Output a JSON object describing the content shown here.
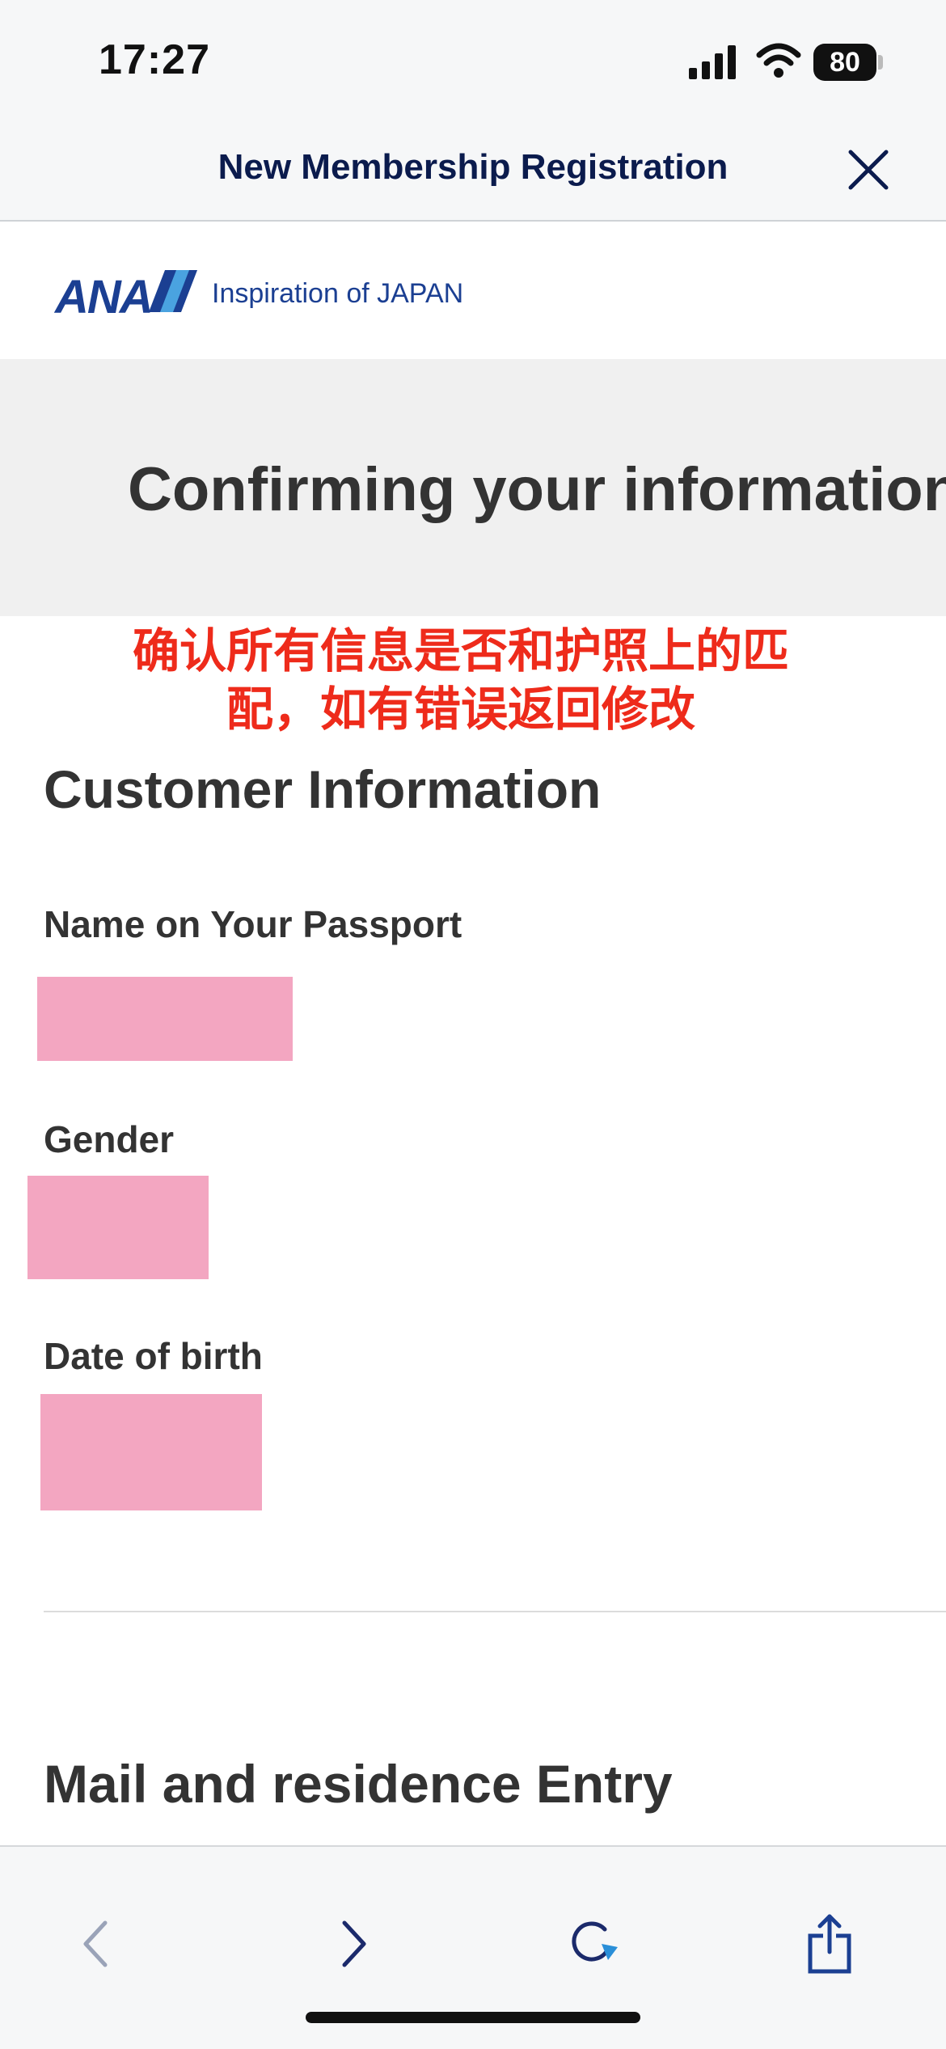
{
  "status_bar": {
    "time": "17:27",
    "battery": "80"
  },
  "header": {
    "title": "New Membership Registration"
  },
  "brand": {
    "logo_text": "ANA",
    "tagline": "Inspiration of JAPAN"
  },
  "page": {
    "heading": "Confirming your information"
  },
  "annotation": {
    "line1": "确认所有信息是否和护照上的匹",
    "line2": "配，如有错误返回修改"
  },
  "customer_section": {
    "title": "Customer Information",
    "fields": [
      {
        "label": "Name on Your Passport"
      },
      {
        "label": "Gender"
      },
      {
        "label": "Date of birth"
      }
    ]
  },
  "mail_section": {
    "title": "Mail and residence Entry"
  },
  "colors": {
    "accent": "#1b3f92",
    "annotation": "#ee2b1b",
    "redaction": "#f3a6c1"
  },
  "toolbar": {
    "icons": [
      "back-icon",
      "forward-icon",
      "reload-icon",
      "share-icon"
    ]
  }
}
